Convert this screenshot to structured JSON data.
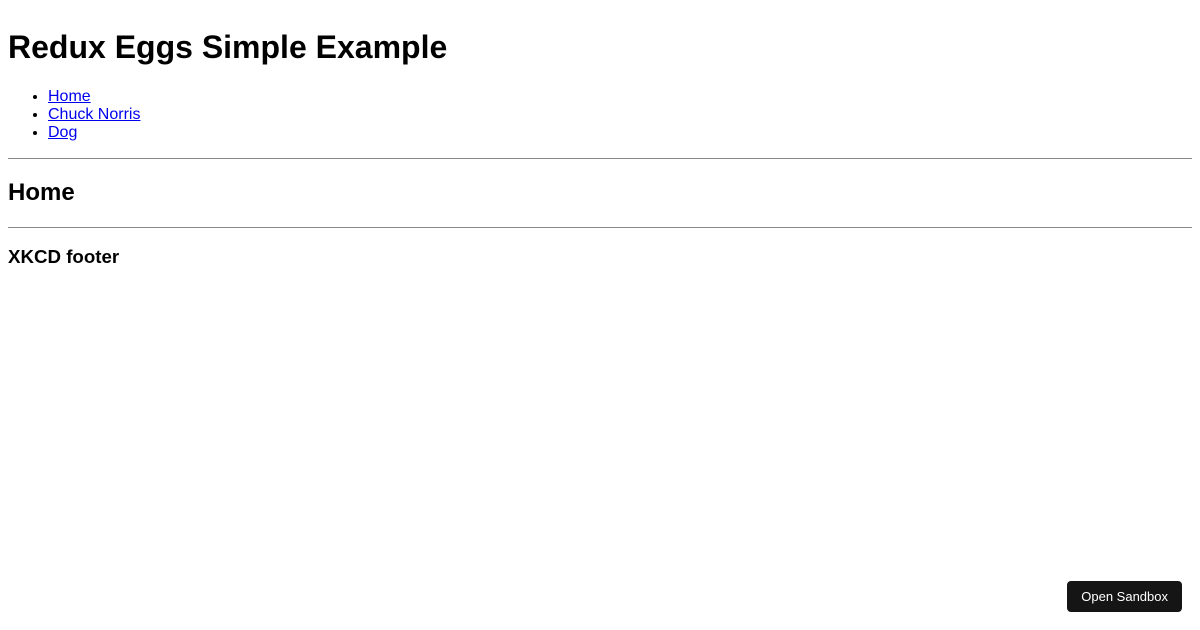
{
  "header": {
    "title": "Redux Eggs Simple Example"
  },
  "nav": {
    "links": [
      {
        "label": "Home"
      },
      {
        "label": "Chuck Norris"
      },
      {
        "label": "Dog"
      }
    ]
  },
  "main": {
    "heading": "Home"
  },
  "footer": {
    "heading": "XKCD footer"
  },
  "sandbox": {
    "button_label": "Open Sandbox"
  }
}
